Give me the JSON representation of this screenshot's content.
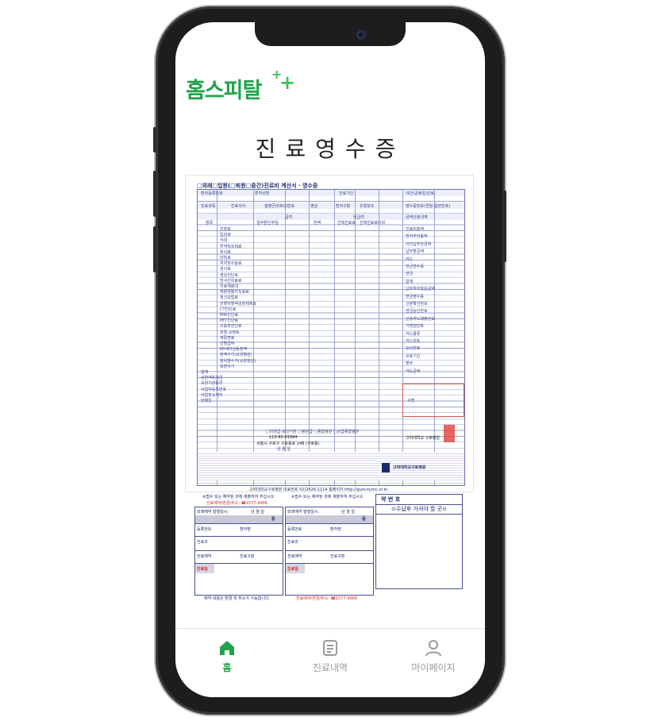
{
  "app": {
    "logo_text": "홈스피탈",
    "logo_plus": "+"
  },
  "page": {
    "title": "진료영수증"
  },
  "receipt": {
    "header": "□외래□입원(□퇴원□중간)진료비 계산서 · 영수증",
    "rows": [
      "환자등록번호",
      "환자성명",
      "진료기간",
      "야간(공휴일)진료",
      "진료과목",
      "진료의사",
      "질병군(DRG)번호",
      "병실",
      "환자구분",
      "유형보조",
      "영수증번호(연월-일련번호)"
    ],
    "col_groups": [
      "항목",
      "급여",
      "비급여",
      "금액산정내역"
    ],
    "sub_cols": [
      "일부본인부담",
      "전액",
      "선택진료료",
      "선택진료료이외"
    ],
    "sub_cols2": [
      "본인부담금",
      "공단부담금",
      "본인부담",
      "진료료",
      "이외"
    ],
    "items": [
      "진찰료",
      "입원료",
      "식대",
      "투약및조제료",
      "주사료",
      "마취료",
      "처치및수술료",
      "검사료",
      "영상진단료",
      "방사선치료료",
      "치료재료대",
      "재활및물리치료료",
      "정신요법료",
      "전혈및혈액성분제제료",
      "CT진단료",
      "MRI진단료",
      "PET진단료",
      "초음파진단료",
      "보철·교정료",
      "제증명료",
      "선별급여",
      "65세이상등정액",
      "정액수가(요양병원)",
      "행위별수가(요양병원)",
      "포괄수가",
      "합계",
      "상한액초과금",
      "요양기관종류",
      "사업자등록번호",
      "사업장소재지",
      "발행일"
    ],
    "right_items": [
      "진료비총액",
      "환자부담총액",
      "이미납부한금액",
      "납부할금액",
      "카드",
      "현금영수증",
      "현금",
      "합계",
      "납부하지않은금액",
      "현금영수증",
      "신분확인번호",
      "현금승인번호",
      "신용카드매출전표",
      "가맹점번호",
      "카드종류",
      "카드번호",
      "승인번호",
      "유효기간",
      "할부",
      "카드금액",
      "서명"
    ],
    "business_no": "113-82-01994",
    "hospital_name": "고려대학교 구로병원",
    "hospital_type_options": "□의원급·보건기관 □병원급 □종합병원 □상급종합병원",
    "address": "서울시 구로구 구로동로 148 (구로동)",
    "issue_date": "년 월 일",
    "footer": "고려대학교구로병원 대표번호 02)2626-1114 홈페이지 http://guro.kumc.or.kr",
    "seal_name": "고려대학교구로병원"
  },
  "slips": [
    {
      "notice": "※접수 또는 예약된 과에 제출하여 주십시오",
      "phone": "· 진료예약/변경/취소: ☎1577-9966",
      "fields": [
        "외래예약 발행일시:",
        "년 월 일",
        "증",
        "등록번호",
        "환자명",
        "진료과",
        "진료예약",
        "진료구분",
        "진료일"
      ],
      "footer": "예약 내용은 변경 및 취소가 가능합니다."
    },
    {
      "notice": "※접수 또는 예약된 과에 제출하여 주십시오",
      "phone": "진료예약/변경/취소: ☎1577-9966",
      "fields": [
        "외래예약 발행일시:",
        "년 월 일",
        "증",
        "등록번호",
        "환자명",
        "진료과",
        "진료예약",
        "진료구분",
        "진료일"
      ],
      "footer": "진료예약/변경/취소: ☎1577-9966"
    }
  ],
  "pharmacy": {
    "title": "약 번 호",
    "subtitle": "⊙수납후 가셔야 할 곳⊙"
  },
  "tabbar": {
    "items": [
      {
        "label": "홈",
        "icon": "home-icon",
        "active": true
      },
      {
        "label": "진료내역",
        "icon": "list-icon",
        "active": false
      },
      {
        "label": "마이페이지",
        "icon": "user-icon",
        "active": false
      }
    ],
    "active_color": "#22a34a",
    "inactive_color": "#9a9a9a"
  }
}
